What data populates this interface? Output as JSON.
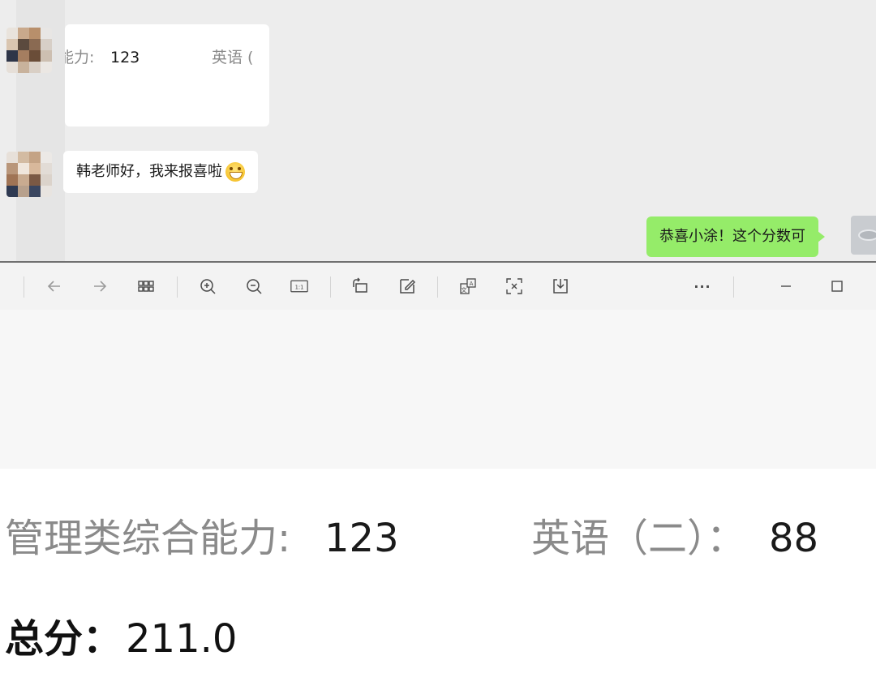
{
  "chat": {
    "image_card": {
      "label1": "能力:",
      "value1": "123",
      "label2": "英语 ("
    },
    "message1": "韩老师好，我来报喜啦",
    "message1_emoji": "grinning-face-emoji",
    "my_message": "恭喜小涂！这个分数可"
  },
  "viewer": {
    "toolbar": [
      {
        "icon": "back-arrow-icon",
        "glyph": "←"
      },
      {
        "icon": "forward-arrow-icon",
        "glyph": "→"
      },
      {
        "icon": "grid-view-icon"
      },
      {
        "icon": "zoom-in-icon"
      },
      {
        "icon": "zoom-out-icon"
      },
      {
        "icon": "actual-size-icon",
        "glyph": "1:1"
      },
      {
        "icon": "rotate-icon"
      },
      {
        "icon": "edit-icon"
      },
      {
        "icon": "translate-icon"
      },
      {
        "icon": "extract-text-icon"
      },
      {
        "icon": "download-icon"
      },
      {
        "icon": "more-icon",
        "glyph": "···"
      },
      {
        "icon": "minimize-icon"
      },
      {
        "icon": "maximize-icon"
      }
    ],
    "document": {
      "subject1_label": "管理类综合能力:",
      "subject1_score": "123",
      "subject2_label": "英语（二）：",
      "subject2_score": "88",
      "total_label": "总分：",
      "total_score": "211.0"
    }
  },
  "colors": {
    "chat_background": "#ededed",
    "my_bubble": "#95ec69",
    "other_bubble": "#ffffff",
    "label_gray": "#8a8a8a"
  }
}
